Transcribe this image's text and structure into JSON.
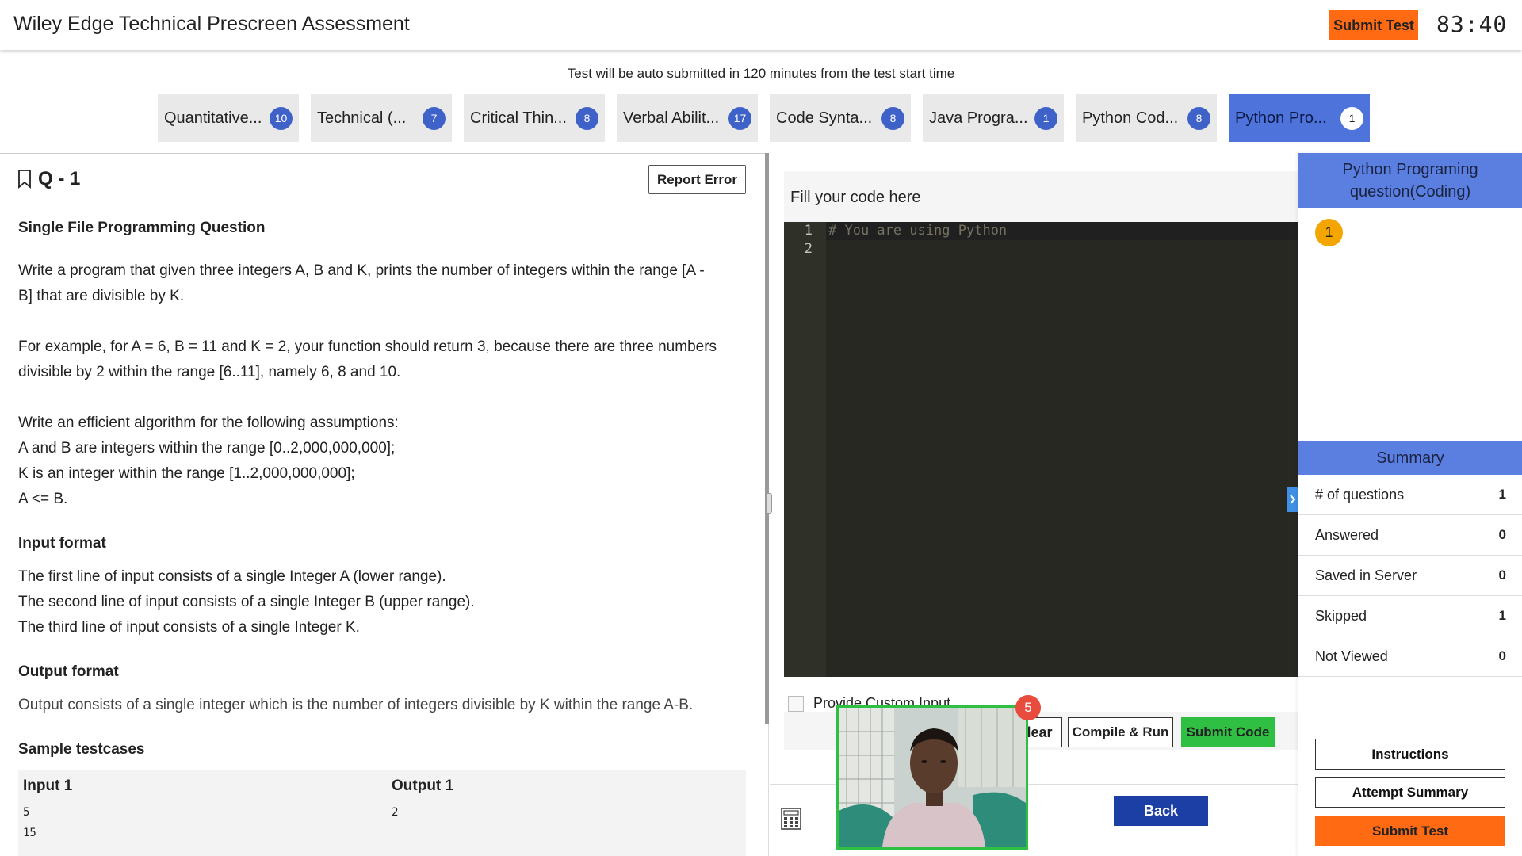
{
  "header": {
    "title": "Wiley Edge Technical Prescreen Assessment",
    "submit_label": "Submit Test",
    "timer": "83:40"
  },
  "notice": "Test will be auto submitted in 120 minutes from the test start time",
  "tabs": [
    {
      "label": "Quantitative...",
      "count": "10"
    },
    {
      "label": "Technical (...",
      "count": "7"
    },
    {
      "label": "Critical Thin...",
      "count": "8"
    },
    {
      "label": "Verbal Abilit...",
      "count": "17"
    },
    {
      "label": "Code Synta...",
      "count": "8"
    },
    {
      "label": "Java Progra...",
      "count": "1"
    },
    {
      "label": "Python Cod...",
      "count": "8"
    },
    {
      "label": "Python Pro...",
      "count": "1"
    }
  ],
  "question": {
    "number": "Q - 1",
    "report_label": "Report Error",
    "type_title": "Single File Programming Question",
    "para1a": "Write a program that given three integers A, B and K, prints the number of integers within the range [A -",
    "para1b": "B] that are divisible by K.",
    "para2a": "For example, for A = 6, B = 11 and K = 2, your function should return 3, because there are three numbers",
    "para2b": "divisible by 2 within the range [6..11], namely 6, 8 and 10.",
    "assump_title": "Write an efficient algorithm for the following assumptions:",
    "assump1": "A and B are integers within the range [0..2,000,000,000];",
    "assump2": "K is an integer within the range [1..2,000,000,000];",
    "assump3": "A <= B.",
    "input_title": "Input format",
    "input1": "The first line of input consists of a single Integer A (lower range).",
    "input2": "The second line of input consists of a single Integer B (upper range).",
    "input3": "The third line of input consists of a single Integer K.",
    "output_title": "Output format",
    "output_text": "Output consists of a single integer which is the number of integers divisible by K within the range A-B.",
    "sample_title": "Sample testcases",
    "sample": {
      "input_header": "Input 1",
      "output_header": "Output 1",
      "input_lines": [
        "5",
        "15"
      ],
      "output_lines": [
        "2"
      ]
    }
  },
  "editor": {
    "header": "Fill your code here",
    "line_numbers": [
      "1",
      "2"
    ],
    "code_line1": "# You are using Python",
    "custom_input_label": "Provide Custom Input",
    "clear_label": "lear",
    "compile_label": "Compile & Run",
    "submit_code_label": "Submit Code",
    "back_label": "Back"
  },
  "webcam": {
    "badge": "5"
  },
  "sidebar": {
    "section_title": "Python Programing question(Coding)",
    "question_bubble": "1",
    "summary_title": "Summary",
    "summary": [
      {
        "label": "# of questions",
        "value": "1"
      },
      {
        "label": "Answered",
        "value": "0"
      },
      {
        "label": "Saved in Server",
        "value": "0"
      },
      {
        "label": "Skipped",
        "value": "1"
      },
      {
        "label": "Not Viewed",
        "value": "0"
      }
    ],
    "instructions_label": "Instructions",
    "attempt_summary_label": "Attempt Summary",
    "submit_label": "Submit Test"
  },
  "colors": {
    "accent_orange": "#ff6a13",
    "tab_active": "#4e73db",
    "badge_blue": "#3f62c8",
    "submit_green": "#2fbf43",
    "back_blue": "#1c3fa5",
    "editor_bg": "#272822"
  }
}
